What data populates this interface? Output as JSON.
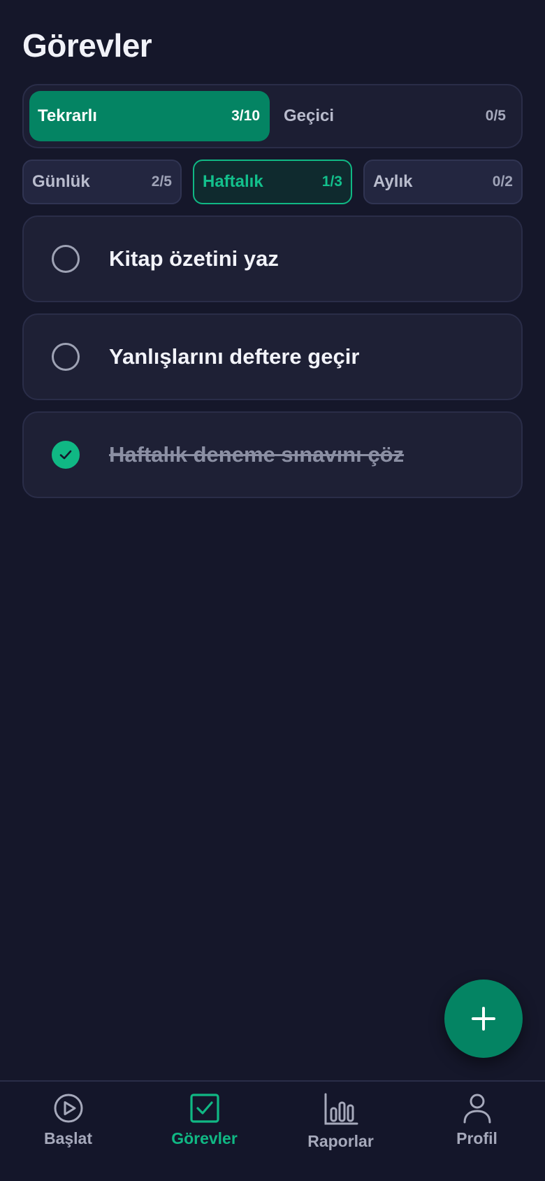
{
  "header": {
    "title": "Görevler"
  },
  "main_tabs": [
    {
      "label": "Tekrarlı",
      "count": "3/10",
      "active": true
    },
    {
      "label": "Geçici",
      "count": "0/5",
      "active": false
    }
  ],
  "period_tabs": [
    {
      "label": "Günlük",
      "count": "2/5",
      "active": false
    },
    {
      "label": "Haftalık",
      "count": "1/3",
      "active": true
    },
    {
      "label": "Aylık",
      "count": "0/2",
      "active": false
    }
  ],
  "tasks": [
    {
      "text": "Kitap özetini yaz",
      "done": false
    },
    {
      "text": "Yanlışlarını deftere geçir",
      "done": false
    },
    {
      "text": "Haftalık deneme sınavını çöz",
      "done": true
    }
  ],
  "fab": {
    "icon": "plus-icon"
  },
  "nav": [
    {
      "label": "Başlat",
      "icon": "play-circle-icon",
      "active": false
    },
    {
      "label": "Görevler",
      "icon": "checkbox-icon",
      "active": true
    },
    {
      "label": "Raporlar",
      "icon": "bar-chart-icon",
      "active": false
    },
    {
      "label": "Profil",
      "icon": "user-icon",
      "active": false
    }
  ],
  "colors": {
    "background": "#15172a",
    "accent": "#048463",
    "accent_bright": "#10b884",
    "card": "#1e2035"
  }
}
